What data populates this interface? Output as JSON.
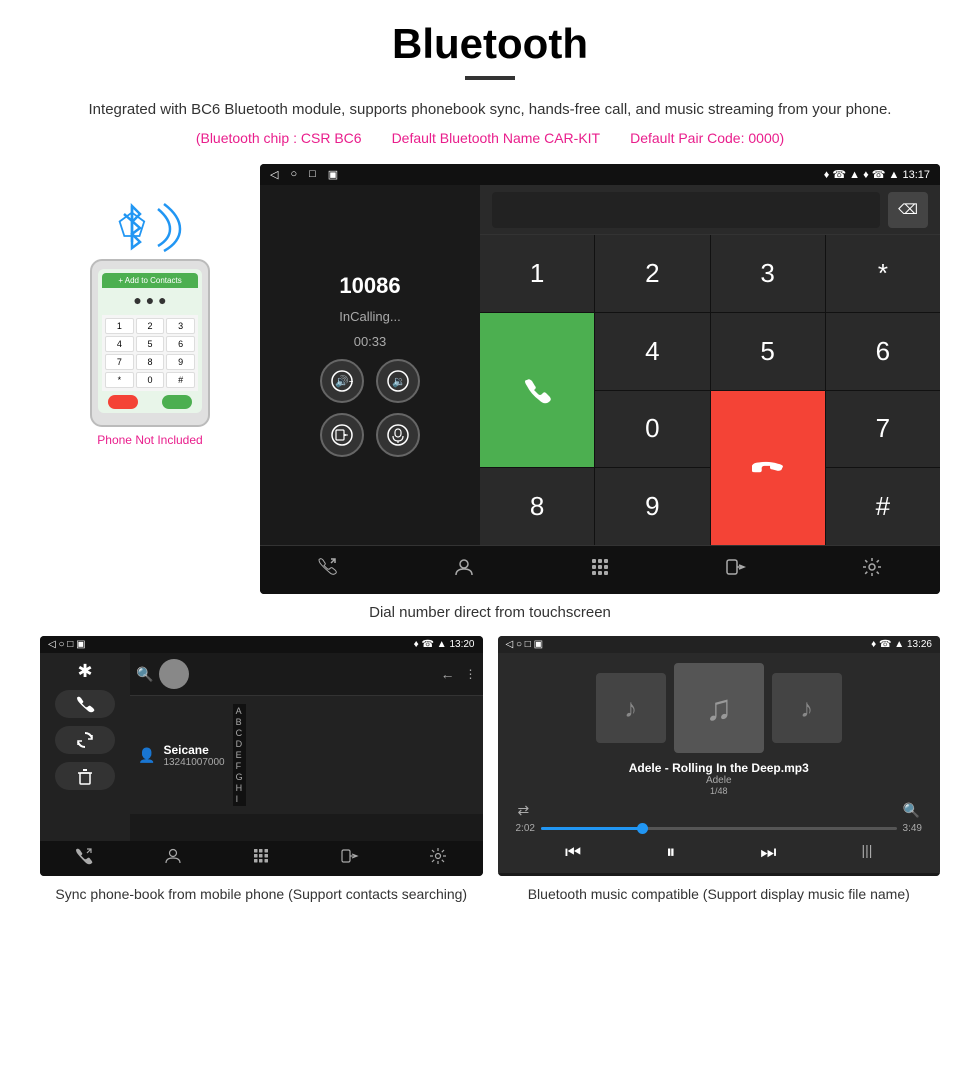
{
  "page": {
    "title": "Bluetooth",
    "subtitle": "Integrated with BC6 Bluetooth module, supports phonebook sync, hands-free call, and music streaming from your phone.",
    "bt_info": {
      "chip": "(Bluetooth chip : CSR BC6",
      "name": "Default Bluetooth Name CAR-KIT",
      "pair_code": "Default Pair Code: 0000)"
    }
  },
  "dialer": {
    "status_bar": {
      "nav_icons": "◁  ○  □  ▣",
      "right_icons": "♦ ☎ ▲ 13:17"
    },
    "call_number": "10086",
    "call_status": "InCalling...",
    "call_timer": "00:33",
    "controls": {
      "vol_up": "🔊+",
      "vol_down": "🔉",
      "transfer": "📲",
      "mic": "🎤"
    },
    "keypad": {
      "keys": [
        "1",
        "2",
        "3",
        "*",
        "4",
        "5",
        "6",
        "0",
        "7",
        "8",
        "9",
        "#"
      ]
    },
    "toolbar": {
      "items": [
        "📞",
        "👤",
        "⊞",
        "📋",
        "⚙"
      ]
    }
  },
  "phonebook": {
    "status_bar": {
      "left": "◁  ○  □  ▣",
      "right": "♦ ☎ ▲ 13:20"
    },
    "contact": {
      "name": "Seicane",
      "number": "13241007000"
    },
    "letters": [
      "A",
      "B",
      "C",
      "D",
      "E",
      "F",
      "G",
      "H",
      "I"
    ],
    "caption": "Sync phone-book from mobile phone\n(Support contacts searching)"
  },
  "music": {
    "status_bar": {
      "left": "◁  ○  □  ▣",
      "right": "♦ ☎ ▲ 13:26"
    },
    "song_title": "Adele - Rolling In the Deep.mp3",
    "artist": "Adele",
    "track_info": "1/48",
    "time_current": "2:02",
    "time_total": "3:49",
    "caption": "Bluetooth music compatible\n(Support display music file name)"
  },
  "phone_label": "Phone Not Included",
  "dialer_caption": "Dial number direct from touchscreen"
}
